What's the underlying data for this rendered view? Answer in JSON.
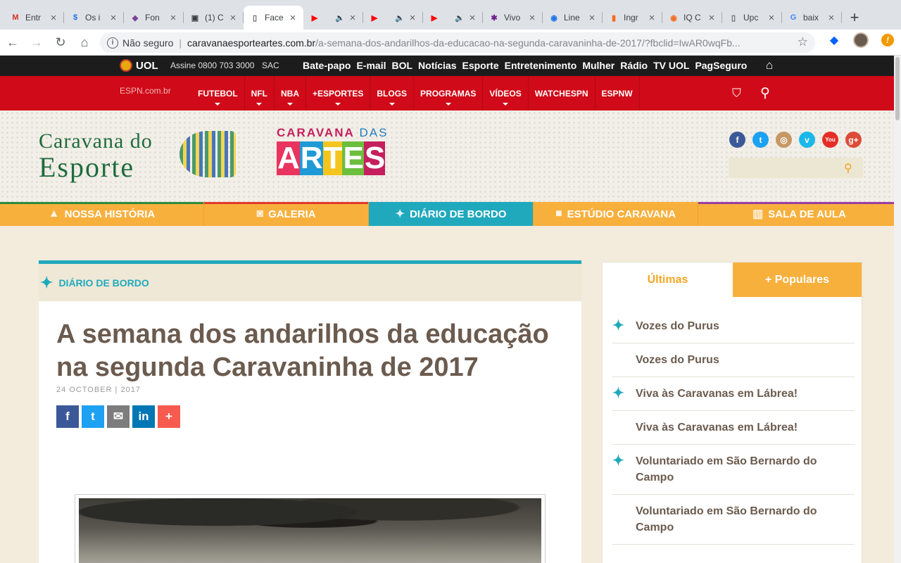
{
  "browser": {
    "tabs": [
      {
        "title": "Entr",
        "icon": "gmail-icon",
        "glyph": "M",
        "color": "#d93025",
        "sound": false
      },
      {
        "title": "Os i",
        "icon": "dollar-icon",
        "glyph": "$",
        "color": "#1a73e8",
        "sound": false
      },
      {
        "title": "Fon",
        "icon": "app-icon",
        "glyph": "◆",
        "color": "#7b4397",
        "sound": false
      },
      {
        "title": "(1) C",
        "icon": "app-icon",
        "glyph": "▣",
        "color": "#3c4043",
        "sound": false
      },
      {
        "title": "Face",
        "icon": "page-icon",
        "glyph": "▯",
        "color": "#5f6368",
        "sound": false,
        "active": true
      },
      {
        "title": "",
        "icon": "youtube-icon",
        "glyph": "▶",
        "color": "#ff0000",
        "sound": true
      },
      {
        "title": "",
        "icon": "youtube-icon",
        "glyph": "▶",
        "color": "#ff0000",
        "sound": true
      },
      {
        "title": "",
        "icon": "youtube-icon",
        "glyph": "▶",
        "color": "#ff0000",
        "sound": true
      },
      {
        "title": "Vivo",
        "icon": "vivo-icon",
        "glyph": "✱",
        "color": "#6b1f8a",
        "sound": false
      },
      {
        "title": "Line",
        "icon": "globe-icon",
        "glyph": "◉",
        "color": "#1a73e8",
        "sound": false
      },
      {
        "title": "Ingr",
        "icon": "app-icon",
        "glyph": "▮",
        "color": "#f46b1e",
        "sound": false
      },
      {
        "title": "IQ C",
        "icon": "chart-icon",
        "glyph": "◉",
        "color": "#f46b1e",
        "sound": false
      },
      {
        "title": "Upc",
        "icon": "page-icon",
        "glyph": "▯",
        "color": "#5f6368",
        "sound": false
      },
      {
        "title": "baix",
        "icon": "google-icon",
        "glyph": "G",
        "color": "#4285f4",
        "sound": false
      }
    ],
    "new_tab": "+",
    "security_label": "Não seguro",
    "url_host": "caravanaesporteartes.com.br",
    "url_path": "/a-semana-dos-andarilhos-da-educacao-na-segunda-caravaninha-de-2017/?fbclid=IwAR0wqFb..."
  },
  "uol": {
    "logo": "UOL",
    "subscribe": "Assine 0800 703 3000",
    "sac": "SAC",
    "links": [
      "Bate-papo",
      "E-mail",
      "BOL",
      "Notícias",
      "Esporte",
      "Entretenimento",
      "Mulher",
      "Rádio",
      "TV UOL",
      "PagSeguro"
    ]
  },
  "espn": {
    "logo_alt": "ESPN.com.br",
    "nav": [
      {
        "label": "FUTEBOL",
        "caret": true
      },
      {
        "label": "NFL",
        "caret": true
      },
      {
        "label": "NBA",
        "caret": true
      },
      {
        "label": "+ESPORTES",
        "caret": true
      },
      {
        "label": "BLOGS",
        "caret": true
      },
      {
        "label": "PROGRAMAS",
        "caret": true
      },
      {
        "label": "VÍDEOS",
        "caret": true
      },
      {
        "label": "WATCHESPN",
        "caret": false
      },
      {
        "label": "ESPNW",
        "caret": false
      }
    ]
  },
  "header": {
    "logo_esporte_line1": "Caravana do",
    "logo_esporte_line2": "Esporte",
    "logo_artes_top": "CARAVANA",
    "logo_artes_top2": "DAS",
    "logo_artes_letters": [
      "A",
      "R",
      "T",
      "E",
      "S"
    ],
    "logo_artes_colors": [
      "#e8345f",
      "#1f9ad6",
      "#f5c51d",
      "#6cbf3d",
      "#c51f5d"
    ],
    "social": [
      {
        "name": "facebook-icon",
        "glyph": "f",
        "color": "#3b5998"
      },
      {
        "name": "twitter-icon",
        "glyph": "t",
        "color": "#1da1f2"
      },
      {
        "name": "instagram-icon",
        "glyph": "◎",
        "color": "#c69866"
      },
      {
        "name": "vimeo-icon",
        "glyph": "v",
        "color": "#1ab7ea"
      },
      {
        "name": "youtube-icon",
        "glyph": "You",
        "color": "#e52d27"
      },
      {
        "name": "googleplus-icon",
        "glyph": "g+",
        "color": "#dd4b39"
      }
    ],
    "search_placeholder": ""
  },
  "sections": [
    {
      "label": "NOSSA HISTÓRIA",
      "icon": "warning-icon",
      "glyph": "▲",
      "bar": "#2e8b3d",
      "width": 290
    },
    {
      "label": "GALERIA",
      "icon": "camera-icon",
      "glyph": "◙",
      "bar": "#e03a2f",
      "width": 234
    },
    {
      "label": "DIÁRIO DE BORDO",
      "icon": "compass-icon",
      "glyph": "✦",
      "bar": "#20a9bd",
      "width": 234,
      "active": true
    },
    {
      "label": "ESTÚDIO CARAVANA",
      "icon": "video-icon",
      "glyph": "■",
      "bar": "#f8b03d",
      "width": 234
    },
    {
      "label": "SALA DE AULA",
      "icon": "book-icon",
      "glyph": "▥",
      "bar": "#9b3fa0",
      "width": 288
    }
  ],
  "article": {
    "section": "DIÁRIO DE BORDO",
    "title": "A semana dos andarilhos da educação na segunda Caravaninha de 2017",
    "date": "24 OCTOBER | 2017",
    "share": [
      {
        "name": "facebook-share-icon",
        "glyph": "f",
        "color": "#3b5998"
      },
      {
        "name": "twitter-share-icon",
        "glyph": "t",
        "color": "#1da1f2"
      },
      {
        "name": "email-share-icon",
        "glyph": "✉",
        "color": "#7d7d7d"
      },
      {
        "name": "linkedin-share-icon",
        "glyph": "in",
        "color": "#0077b5"
      },
      {
        "name": "more-share-icon",
        "glyph": "+",
        "color": "#f65b4e"
      }
    ]
  },
  "sidebar": {
    "tabs": [
      "Últimas",
      "+ Populares"
    ],
    "items": [
      {
        "title": "Vozes do Purus",
        "icon": true
      },
      {
        "title": "Vozes do Purus",
        "icon": false
      },
      {
        "title": "Viva às Caravanas em Lábrea!",
        "icon": true
      },
      {
        "title": "Viva às Caravanas em Lábrea!",
        "icon": false
      },
      {
        "title": "Voluntariado em São Bernardo do Campo",
        "icon": true
      },
      {
        "title": "Voluntariado em São Bernardo do Campo",
        "icon": false
      }
    ]
  }
}
